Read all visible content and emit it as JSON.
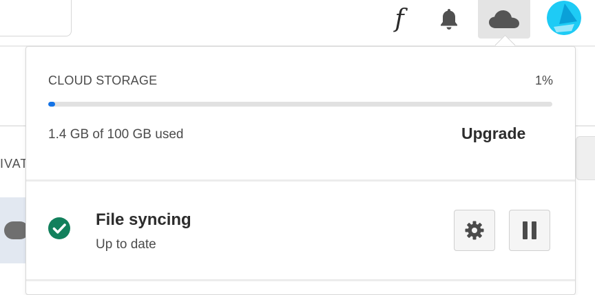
{
  "header": {
    "search": {
      "placeholder": ""
    },
    "icons": [
      "fonts-icon",
      "bell-icon",
      "cloud-icon",
      "avatar"
    ]
  },
  "background": {
    "tab_text": "IVAT"
  },
  "panel": {
    "storage": {
      "title": "CLOUD STORAGE",
      "percent_label": "1%",
      "used_label": "1.4 GB of 100 GB used",
      "used_fraction": 0.014,
      "upgrade_label": "Upgrade"
    },
    "sync": {
      "title": "File syncing",
      "status": "Up to date",
      "icons": [
        "check-circle-icon",
        "gear-icon",
        "pause-icon"
      ]
    }
  },
  "colors": {
    "accent": "#1473e6",
    "success": "#12805c",
    "avatar": "#1ecbf5"
  }
}
